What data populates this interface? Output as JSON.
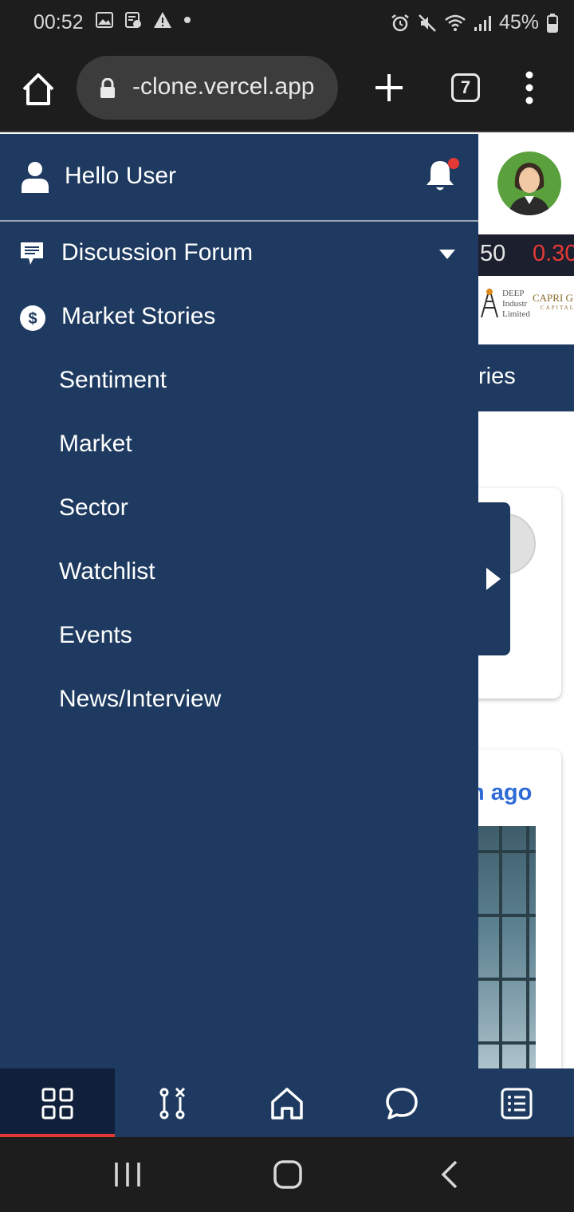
{
  "status_bar": {
    "time": "00:52",
    "battery": "45%"
  },
  "browser": {
    "url": "-clone.vercel.app",
    "tab_count": "7"
  },
  "drawer": {
    "greeting": "Hello User",
    "items": [
      {
        "label": "Discussion Forum",
        "icon": "chat-icon",
        "has_caret": true
      },
      {
        "label": "Market Stories",
        "icon": "dollar-icon"
      }
    ],
    "sub_items": [
      {
        "label": "Sentiment"
      },
      {
        "label": "Market"
      },
      {
        "label": "Sector"
      },
      {
        "label": "Watchlist"
      },
      {
        "label": "Events"
      },
      {
        "label": "News/Interview"
      }
    ]
  },
  "background": {
    "ticker_value_1": "50",
    "ticker_value_2": "0.30",
    "logo_deep": [
      "DEEP",
      "Industr",
      "Limited"
    ],
    "logo_capri": "CAPRI G",
    "logo_capri_sub": "CAPITAL",
    "tab_partial": "ries",
    "card_time_partial": "n ago"
  },
  "bottom_nav": {
    "items": [
      {
        "icon": "grid-icon",
        "active": true
      },
      {
        "icon": "routes-icon"
      },
      {
        "icon": "home-icon"
      },
      {
        "icon": "chat-bubble-icon"
      },
      {
        "icon": "list-icon"
      }
    ]
  },
  "colors": {
    "drawer_bg": "#1e3a60",
    "accent_red": "#e53935",
    "link_blue": "#2f6bd6"
  }
}
